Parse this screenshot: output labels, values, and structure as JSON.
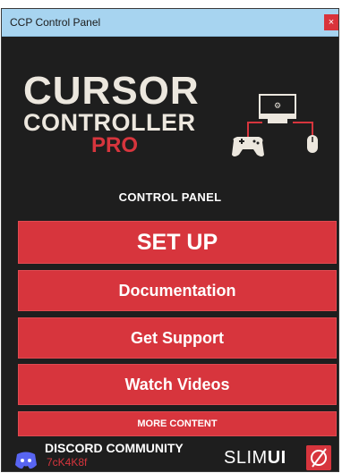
{
  "window": {
    "title": "CCP Control Panel",
    "close_glyph": "×"
  },
  "brand": {
    "line1": "CURSOR",
    "line2": "CONTROLLER",
    "line3": "PRO",
    "icon": "gamepad-monitor-mouse-icon"
  },
  "panel": {
    "heading": "CONTROL PANEL",
    "buttons": {
      "setup": "SET UP",
      "documentation": "Documentation",
      "support": "Get Support",
      "videos": "Watch Videos",
      "more": "MORE CONTENT"
    }
  },
  "footer": {
    "discord_title": "DISCORD COMMUNITY",
    "discord_code": "7cK4K8f",
    "slimui_light": "SLIM",
    "slimui_bold": "UI",
    "slimui_icon": "slash-circle-icon"
  },
  "colors": {
    "accent": "#d7353d",
    "background": "#1e1e1e",
    "titlebar": "#a7d4f0",
    "brand_text": "#ece7de"
  }
}
